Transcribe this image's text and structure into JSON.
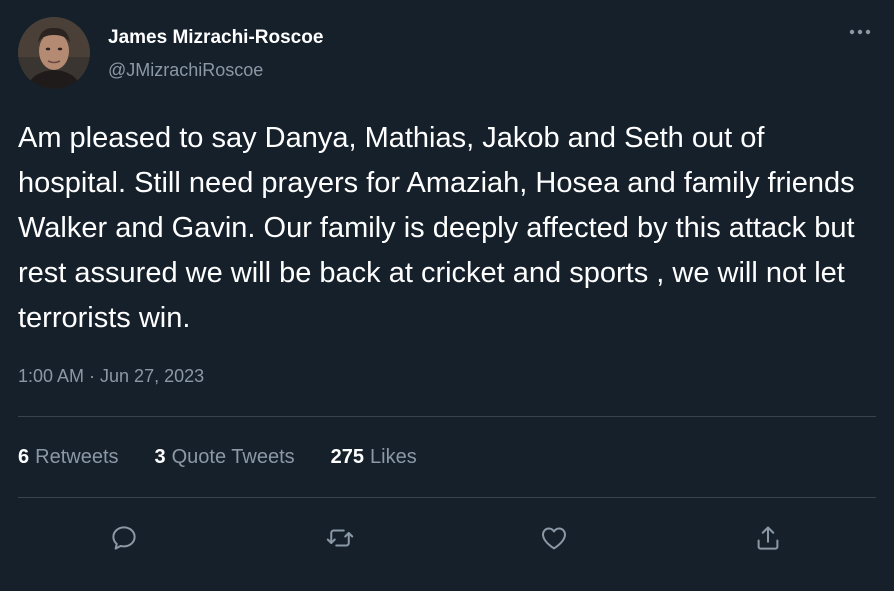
{
  "tweet": {
    "author": {
      "name": "James Mizrachi-Roscoe",
      "handle": "@JMizrachiRoscoe"
    },
    "text": "Am pleased to say Danya, Mathias, Jakob and Seth out of hospital. Still need prayers for Amaziah, Hosea and family friends Walker and Gavin. Our family is deeply affected by this attack but rest assured we will be back at cricket and sports , we will not let terrorists win.",
    "timestamp": "1:00 AM · Jun 27, 2023",
    "stats": {
      "retweets_count": "6",
      "retweets_label": "Retweets",
      "quotes_count": "3",
      "quotes_label": "Quote Tweets",
      "likes_count": "275",
      "likes_label": "Likes"
    },
    "actions": [
      {
        "icon": "reply-icon"
      },
      {
        "icon": "retweet-icon"
      },
      {
        "icon": "like-icon"
      },
      {
        "icon": "share-icon"
      }
    ]
  },
  "theme": {
    "background": "#15202b",
    "text_primary": "#ffffff",
    "text_secondary": "#8b98a5",
    "divider": "#38444d"
  }
}
